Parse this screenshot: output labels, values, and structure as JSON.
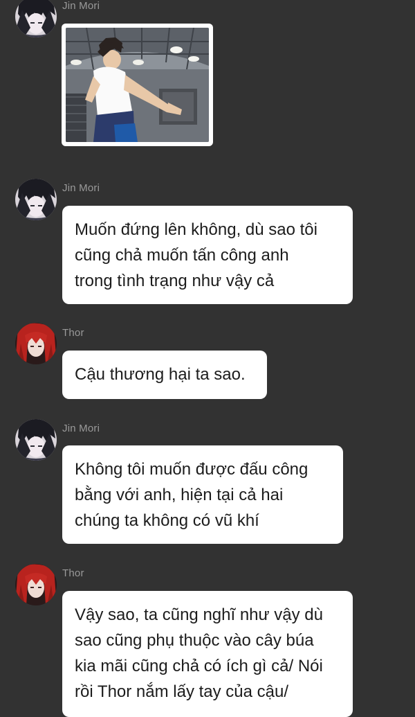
{
  "messages": [
    {
      "author": "Jin Mori",
      "type": "image"
    },
    {
      "author": "Jin Mori",
      "type": "text",
      "text": "Muốn đứng lên không, dù sao tôi\ncũng chả muốn tấn công anh\ntrong tình trạng như vậy cả"
    },
    {
      "author": "Thor",
      "type": "text",
      "text": "Cậu thương hại ta sao."
    },
    {
      "author": "Jin Mori",
      "type": "text",
      "text": "Không tôi muốn được đấu công\nbằng với anh, hiện tại cả hai\nchúng ta không có vũ khí"
    },
    {
      "author": "Thor",
      "type": "text",
      "text": "Vậy sao, ta cũng nghĩ như vậy dù\nsao cũng phụ thuộc vào cây búa\nkia mãi cũng chả có ích gì cả/ Nói\nrồi Thor nắm lấy tay của cậu/"
    }
  ],
  "colors": {
    "background": "#323232",
    "bubble": "#ffffff",
    "author_name": "#9a9a9a",
    "bubble_text": "#1c1c1c"
  },
  "avatars": {
    "jin_mori": "dark-haired-character-avatar",
    "thor": "red-haired-character-avatar"
  }
}
